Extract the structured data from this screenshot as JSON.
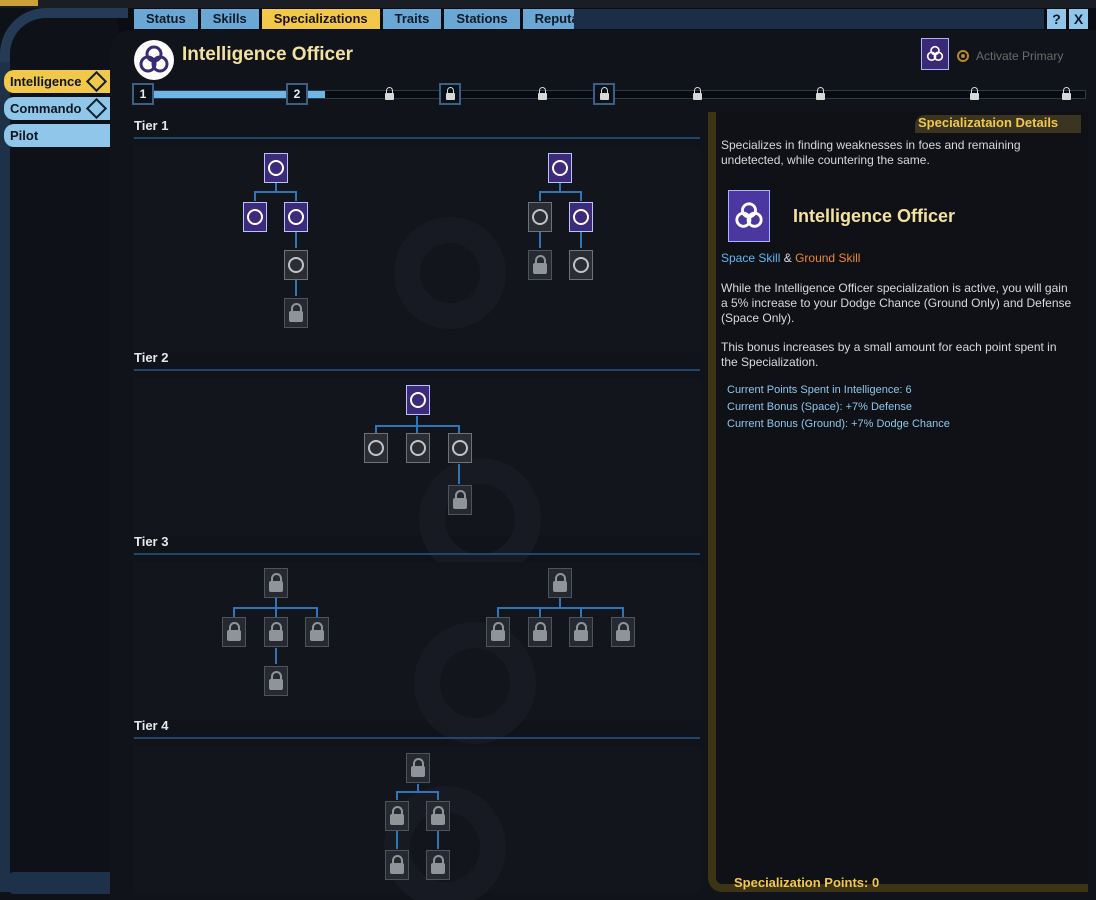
{
  "tabs": [
    "Status",
    "Skills",
    "Specializations",
    "Traits",
    "Stations",
    "Reputation"
  ],
  "active_tab": "Specializations",
  "window_buttons": {
    "help": "?",
    "close": "X"
  },
  "sidebar": {
    "items": [
      "Intelligence",
      "Commando",
      "Pilot"
    ],
    "active": "Intelligence"
  },
  "header": {
    "title": "Intelligence Officer",
    "activate_label": "Activate Primary",
    "icon": "intelligence-officer-icon"
  },
  "progress": {
    "milestones": [
      "1",
      "2"
    ],
    "fill_fraction": 0.19
  },
  "tiers": [
    {
      "label": "Tier 1"
    },
    {
      "label": "Tier 2"
    },
    {
      "label": "Tier 3"
    },
    {
      "label": "Tier 4"
    }
  ],
  "details": {
    "title": "Specializataion Details",
    "description": "Specializes in finding weaknesses in foes and remaining undetected, while countering the same.",
    "name": "Intelligence Officer",
    "space_skill": "Space Skill",
    "amp": "&",
    "ground_skill": "Ground Skill",
    "body1": "While the Intelligence Officer specialization is active, you will gain a 5% increase to your Dodge Chance (Ground Only) and Defense (Space Only).",
    "body2": "This bonus increases by a small amount for each point spent in the Specialization.",
    "stats": [
      "Current Points Spent in Intelligence: 6",
      "Current Bonus (Space): +7% Defense",
      "Current Bonus (Ground): +7% Dodge Chance"
    ],
    "points_label": "Specialization Points: 0"
  },
  "colors": {
    "accent": "#f2c84b",
    "tab": "#6aa7d4",
    "space": "#5fb6f0",
    "ground": "#e88a2d",
    "connector": "#2f75b8"
  }
}
